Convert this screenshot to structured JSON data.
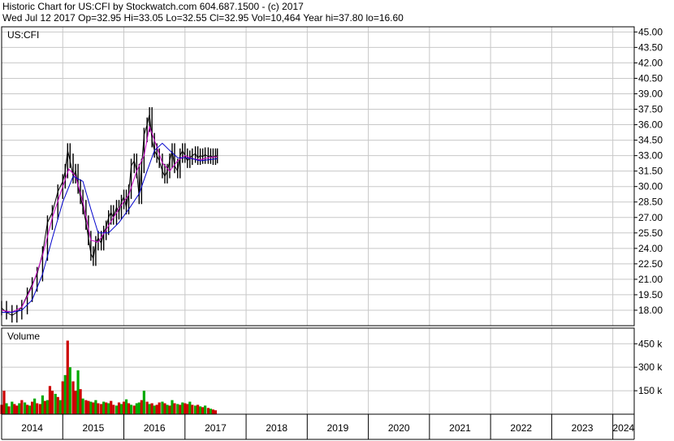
{
  "header": {
    "line1": "Historic Chart for US:CFI by Stockwatch.com 604.687.1500 - (c) 2017",
    "line2": "Wed Jul 12 2017   Op=32.95   Hi=33.05   Lo=32.55   Cl=32.95   Vol=10,464   Year hi=37.80   lo=16.60"
  },
  "chart_data": [
    {
      "type": "line",
      "title": "US:CFI",
      "y_ticks": [
        "45.00",
        "43.50",
        "42.00",
        "40.50",
        "39.00",
        "37.50",
        "36.00",
        "34.50",
        "33.00",
        "31.50",
        "30.00",
        "28.50",
        "27.00",
        "25.50",
        "24.00",
        "22.50",
        "21.00",
        "19.50",
        "18.00"
      ],
      "ylim": [
        16.5,
        45.5
      ],
      "x_ticks": [
        "2014",
        "2015",
        "2016",
        "2017",
        "2018",
        "2019",
        "2020",
        "2021",
        "2022",
        "2023",
        "2024"
      ],
      "xlim": [
        2014.0,
        2024.35
      ],
      "colors": {
        "price": "#000000",
        "ma_short": "#cc00cc",
        "ma_long": "#0000cc",
        "grid": "#c8c8c8"
      },
      "series": [
        {
          "role": "price",
          "x": [
            2014.0,
            2014.08,
            2014.17,
            2014.25,
            2014.33,
            2014.42,
            2014.5,
            2014.58,
            2014.67,
            2014.75,
            2014.83,
            2014.92,
            2015.0,
            2015.04,
            2015.08,
            2015.12,
            2015.17,
            2015.21,
            2015.25,
            2015.29,
            2015.33,
            2015.38,
            2015.42,
            2015.46,
            2015.5,
            2015.54,
            2015.58,
            2015.63,
            2015.67,
            2015.71,
            2015.75,
            2015.79,
            2015.83,
            2015.88,
            2015.92,
            2015.96,
            2016.0,
            2016.04,
            2016.08,
            2016.12,
            2016.17,
            2016.21,
            2016.25,
            2016.29,
            2016.33,
            2016.38,
            2016.42,
            2016.46,
            2016.5,
            2016.54,
            2016.58,
            2016.63,
            2016.67,
            2016.71,
            2016.75,
            2016.79,
            2016.83,
            2016.88,
            2016.92,
            2016.96,
            2017.0,
            2017.04,
            2017.08,
            2017.12,
            2017.17,
            2017.21,
            2017.25,
            2017.29,
            2017.33,
            2017.38,
            2017.42,
            2017.46,
            2017.5,
            2017.53
          ],
          "y": [
            18.2,
            17.8,
            17.5,
            17.8,
            18.3,
            19.5,
            20.5,
            21.5,
            23.5,
            26.5,
            27.5,
            29.5,
            30.5,
            31.5,
            33.5,
            32.5,
            31.0,
            31.5,
            30.0,
            29.0,
            28.0,
            26.5,
            25.0,
            23.5,
            23.0,
            24.5,
            25.0,
            24.5,
            25.5,
            26.0,
            27.0,
            27.5,
            27.0,
            28.0,
            27.5,
            28.5,
            29.0,
            28.0,
            29.5,
            32.0,
            32.5,
            31.5,
            29.0,
            32.0,
            35.0,
            36.0,
            37.0,
            34.5,
            33.5,
            33.0,
            32.5,
            31.5,
            31.0,
            31.5,
            32.5,
            33.5,
            32.0,
            31.5,
            33.0,
            33.5,
            33.0,
            32.5,
            32.8,
            33.0,
            33.2,
            32.8,
            33.0,
            32.9,
            33.1,
            32.9,
            33.0,
            32.8,
            33.0,
            32.95
          ]
        },
        {
          "role": "ma_short",
          "x": [
            2014.0,
            2014.17,
            2014.33,
            2014.5,
            2014.67,
            2014.83,
            2015.0,
            2015.1,
            2015.21,
            2015.33,
            2015.46,
            2015.58,
            2015.71,
            2015.83,
            2015.96,
            2016.08,
            2016.21,
            2016.33,
            2016.42,
            2016.5,
            2016.63,
            2016.75,
            2016.88,
            2017.0,
            2017.12,
            2017.25,
            2017.38,
            2017.53
          ],
          "y": [
            18.0,
            17.8,
            18.3,
            20.3,
            23.3,
            27.0,
            30.0,
            31.7,
            31.0,
            28.5,
            24.8,
            24.6,
            25.8,
            27.0,
            28.2,
            29.2,
            31.5,
            33.0,
            35.8,
            34.5,
            32.3,
            31.5,
            32.5,
            33.0,
            32.7,
            32.6,
            32.8,
            32.9
          ]
        },
        {
          "role": "ma_long",
          "x": [
            2014.0,
            2014.17,
            2014.33,
            2014.5,
            2014.67,
            2014.83,
            2015.0,
            2015.17,
            2015.33,
            2015.46,
            2015.58,
            2015.75,
            2015.92,
            2016.08,
            2016.25,
            2016.38,
            2016.5,
            2016.63,
            2016.75,
            2016.88,
            2017.0,
            2017.12,
            2017.25,
            2017.38,
            2017.53
          ],
          "y": [
            17.8,
            17.8,
            18.0,
            19.0,
            21.5,
            25.0,
            28.5,
            31.0,
            30.5,
            27.8,
            25.5,
            25.5,
            26.5,
            27.8,
            29.3,
            31.5,
            33.5,
            34.2,
            33.5,
            32.8,
            32.8,
            32.7,
            32.5,
            32.6,
            32.7
          ]
        }
      ]
    },
    {
      "type": "bar",
      "title": "Volume",
      "y_ticks": [
        "450 k",
        "300 k",
        "150 k"
      ],
      "y_tick_values": [
        450,
        300,
        150
      ],
      "ylim": [
        0,
        550
      ],
      "units": "k",
      "colors": {
        "up": "#00aa00",
        "down": "#cc0000",
        "neutral": "#000000"
      },
      "x": [
        2014.0,
        2014.04,
        2014.08,
        2014.12,
        2014.17,
        2014.21,
        2014.25,
        2014.29,
        2014.33,
        2014.38,
        2014.42,
        2014.46,
        2014.5,
        2014.54,
        2014.58,
        2014.63,
        2014.67,
        2014.71,
        2014.75,
        2014.79,
        2014.83,
        2014.88,
        2014.92,
        2014.96,
        2015.0,
        2015.04,
        2015.08,
        2015.12,
        2015.17,
        2015.21,
        2015.25,
        2015.29,
        2015.33,
        2015.38,
        2015.42,
        2015.46,
        2015.5,
        2015.54,
        2015.58,
        2015.63,
        2015.67,
        2015.71,
        2015.75,
        2015.79,
        2015.83,
        2015.88,
        2015.92,
        2015.96,
        2016.0,
        2016.04,
        2016.08,
        2016.12,
        2016.17,
        2016.21,
        2016.25,
        2016.29,
        2016.33,
        2016.38,
        2016.42,
        2016.46,
        2016.5,
        2016.54,
        2016.58,
        2016.63,
        2016.67,
        2016.71,
        2016.75,
        2016.79,
        2016.83,
        2016.88,
        2016.92,
        2016.96,
        2017.0,
        2017.04,
        2017.08,
        2017.12,
        2017.17,
        2017.21,
        2017.25,
        2017.29,
        2017.33,
        2017.38,
        2017.42,
        2017.46,
        2017.5
      ],
      "values": [
        60,
        150,
        70,
        50,
        80,
        65,
        55,
        70,
        90,
        75,
        60,
        55,
        80,
        100,
        70,
        65,
        120,
        85,
        90,
        180,
        150,
        130,
        110,
        90,
        210,
        250,
        470,
        300,
        210,
        150,
        280,
        160,
        100,
        90,
        85,
        80,
        75,
        90,
        70,
        65,
        80,
        75,
        70,
        85,
        60,
        55,
        75,
        65,
        80,
        95,
        70,
        60,
        55,
        70,
        75,
        90,
        150,
        80,
        65,
        70,
        55,
        60,
        75,
        80,
        70,
        60,
        55,
        90,
        70,
        65,
        60,
        75,
        70,
        65,
        80,
        60,
        55,
        60,
        50,
        45,
        55,
        40,
        35,
        30,
        25
      ],
      "directions": [
        "d",
        "d",
        "u",
        "d",
        "u",
        "d",
        "d",
        "u",
        "d",
        "u",
        "d",
        "u",
        "d",
        "u",
        "d",
        "d",
        "u",
        "d",
        "u",
        "d",
        "d",
        "u",
        "d",
        "u",
        "d",
        "u",
        "d",
        "u",
        "d",
        "d",
        "u",
        "d",
        "u",
        "d",
        "d",
        "u",
        "d",
        "u",
        "d",
        "d",
        "u",
        "d",
        "u",
        "d",
        "d",
        "u",
        "d",
        "u",
        "d",
        "u",
        "d",
        "u",
        "d",
        "u",
        "u",
        "d",
        "u",
        "d",
        "u",
        "d",
        "u",
        "d",
        "d",
        "u",
        "d",
        "u",
        "d",
        "u",
        "d",
        "u",
        "d",
        "u",
        "d",
        "d",
        "u",
        "d",
        "u",
        "d",
        "u",
        "d",
        "u",
        "d",
        "u",
        "d",
        "d"
      ]
    }
  ]
}
